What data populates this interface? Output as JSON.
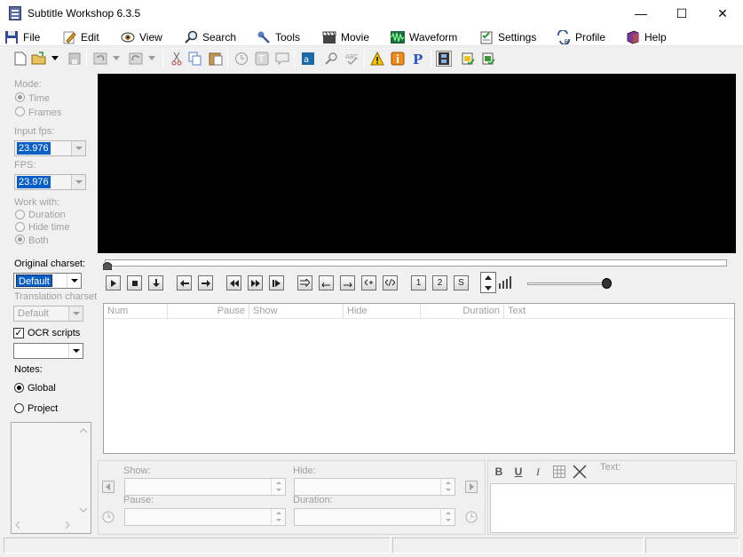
{
  "window": {
    "title": "Subtitle Workshop 6.3.5",
    "min_glyph": "—",
    "max_glyph": "☐",
    "close_glyph": "✕"
  },
  "menu": [
    {
      "label": "File",
      "icon": "floppy-icon"
    },
    {
      "label": "Edit",
      "icon": "pencil-icon"
    },
    {
      "label": "View",
      "icon": "eye-icon"
    },
    {
      "label": "Search",
      "icon": "magnifier-icon"
    },
    {
      "label": "Tools",
      "icon": "wrench-icon"
    },
    {
      "label": "Movie",
      "icon": "clapper-icon"
    },
    {
      "label": "Waveform",
      "icon": "waveform-icon"
    },
    {
      "label": "Settings",
      "icon": "checklist-icon"
    },
    {
      "label": "Profile",
      "icon": "profile-arrows-icon"
    },
    {
      "label": "Help",
      "icon": "book-icon"
    }
  ],
  "left": {
    "mode_label": "Mode:",
    "mode_time": "Time",
    "mode_frames": "Frames",
    "input_fps_label": "Input fps:",
    "input_fps_value": "23.976",
    "fps_label": "FPS:",
    "fps_value": "23.976",
    "work_with_label": "Work with:",
    "work_duration": "Duration",
    "work_hide_time": "Hide time",
    "work_both": "Both",
    "original_charset_label": "Original charset:",
    "original_charset_value": "Default",
    "translation_charset_label": "Translation charset",
    "translation_charset_value": "Default",
    "ocr_scripts_label": "OCR scripts",
    "ocr_scripts_check": "✓",
    "notes_label": "Notes:",
    "notes_global": "Global",
    "notes_project": "Project"
  },
  "list": {
    "columns": [
      "Num",
      "Pause",
      "Show",
      "Hide",
      "Duration",
      "Text"
    ]
  },
  "editor": {
    "show_label": "Show:",
    "hide_label": "Hide:",
    "pause_label": "Pause:",
    "duration_label": "Duration:",
    "text_label": "Text:",
    "bold": "B",
    "underline": "U",
    "italic": "I"
  },
  "player": {
    "btn_1": "1",
    "btn_2": "2",
    "btn_s": "S"
  },
  "colors": {
    "accent": "#0a5ec7",
    "video_bg": "#000000"
  }
}
